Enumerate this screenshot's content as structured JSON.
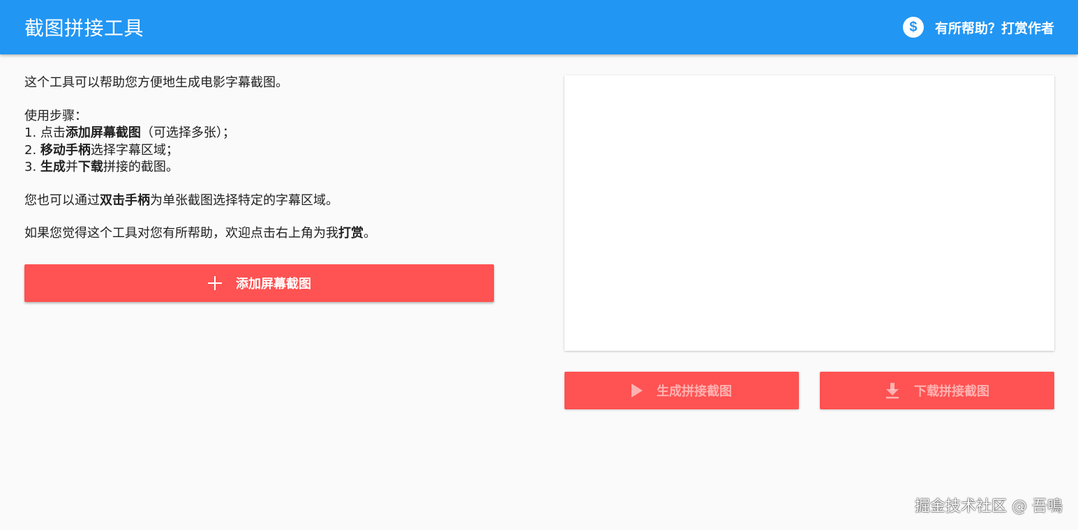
{
  "header": {
    "title": "截图拼接工具",
    "donate_label": "有所帮助？打赏作者",
    "donate_icon": "dollar-circle-icon"
  },
  "intro": {
    "description": "这个工具可以帮助您方便地生成电影字幕截图。",
    "steps_title": "使用步骤：",
    "step1_prefix": "1. 点击",
    "step1_bold": "添加屏幕截图",
    "step1_suffix": "（可选择多张）；",
    "step2_prefix": "2. ",
    "step2_bold": "移动手柄",
    "step2_suffix": "选择字幕区域；",
    "step3_prefix": "3. ",
    "step3_bold1": "生成",
    "step3_mid": "并",
    "step3_bold2": "下载",
    "step3_suffix": "拼接的截图。",
    "tip_prefix": "您也可以通过",
    "tip_bold": "双击手柄",
    "tip_suffix": "为单张截图选择特定的字幕区域。",
    "thanks_prefix": "如果您觉得这个工具对您有所帮助，欢迎点击右上角为我",
    "thanks_bold": "打赏",
    "thanks_suffix": "。"
  },
  "buttons": {
    "add_screenshot": "添加屏幕截图",
    "generate": "生成拼接截图",
    "download": "下载拼接截图"
  },
  "icons": {
    "add": "plus-icon",
    "generate": "play-icon",
    "download": "download-icon"
  },
  "watermark": "掘金技术社区 @ 吾鳴",
  "colors": {
    "app_bar": "#2196f3",
    "accent": "#ff5252",
    "background": "#fafafa"
  }
}
